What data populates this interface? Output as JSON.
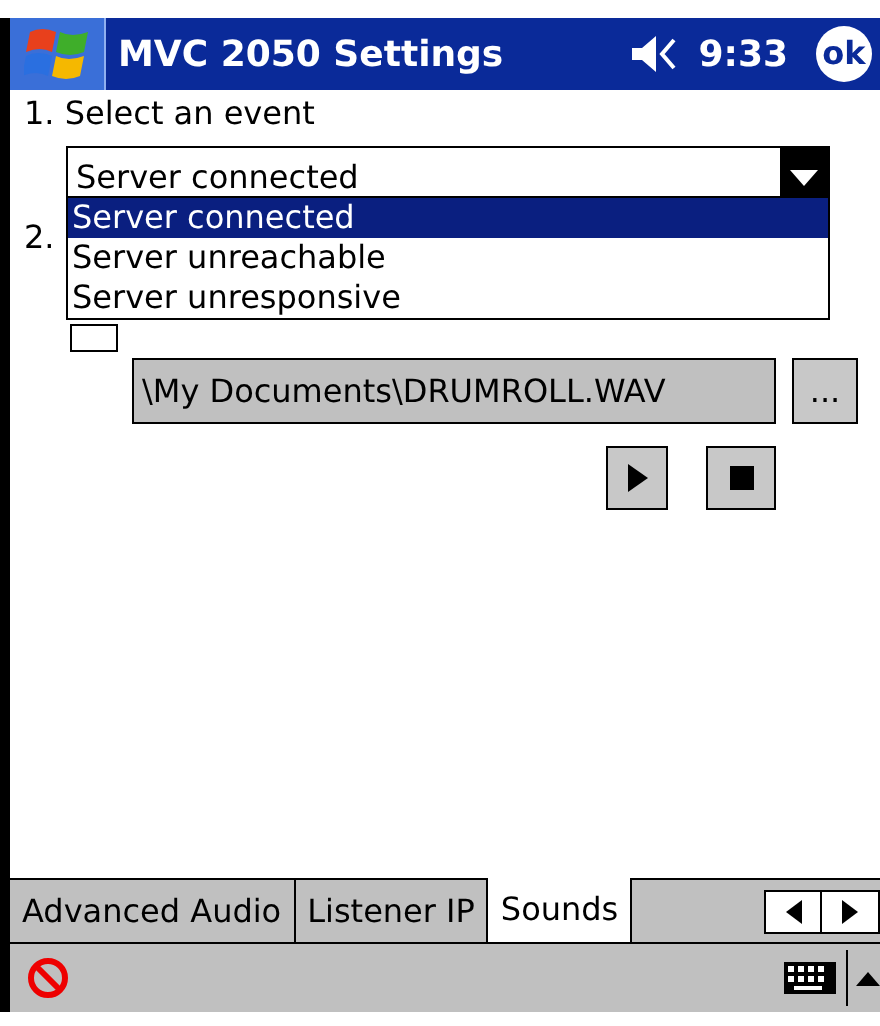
{
  "title_bar": {
    "title": "MVC 2050 Settings",
    "time": "9:33",
    "ok": "ok"
  },
  "step1": {
    "label": "1. Select an event",
    "dropdown": {
      "value": "Server connected",
      "options": [
        {
          "label": "Server connected",
          "selected": true
        },
        {
          "label": "Server unreachable",
          "selected": false
        },
        {
          "label": "Server unresponsive",
          "selected": false
        }
      ]
    }
  },
  "step2": {
    "label": "2.",
    "checked": false,
    "file_path": "\\My Documents\\DRUMROLL.WAV",
    "browse": "..."
  },
  "tabs": [
    {
      "label": "Advanced Audio",
      "selected": false
    },
    {
      "label": "Listener IP",
      "selected": false
    },
    {
      "label": "Sounds",
      "selected": true
    }
  ]
}
